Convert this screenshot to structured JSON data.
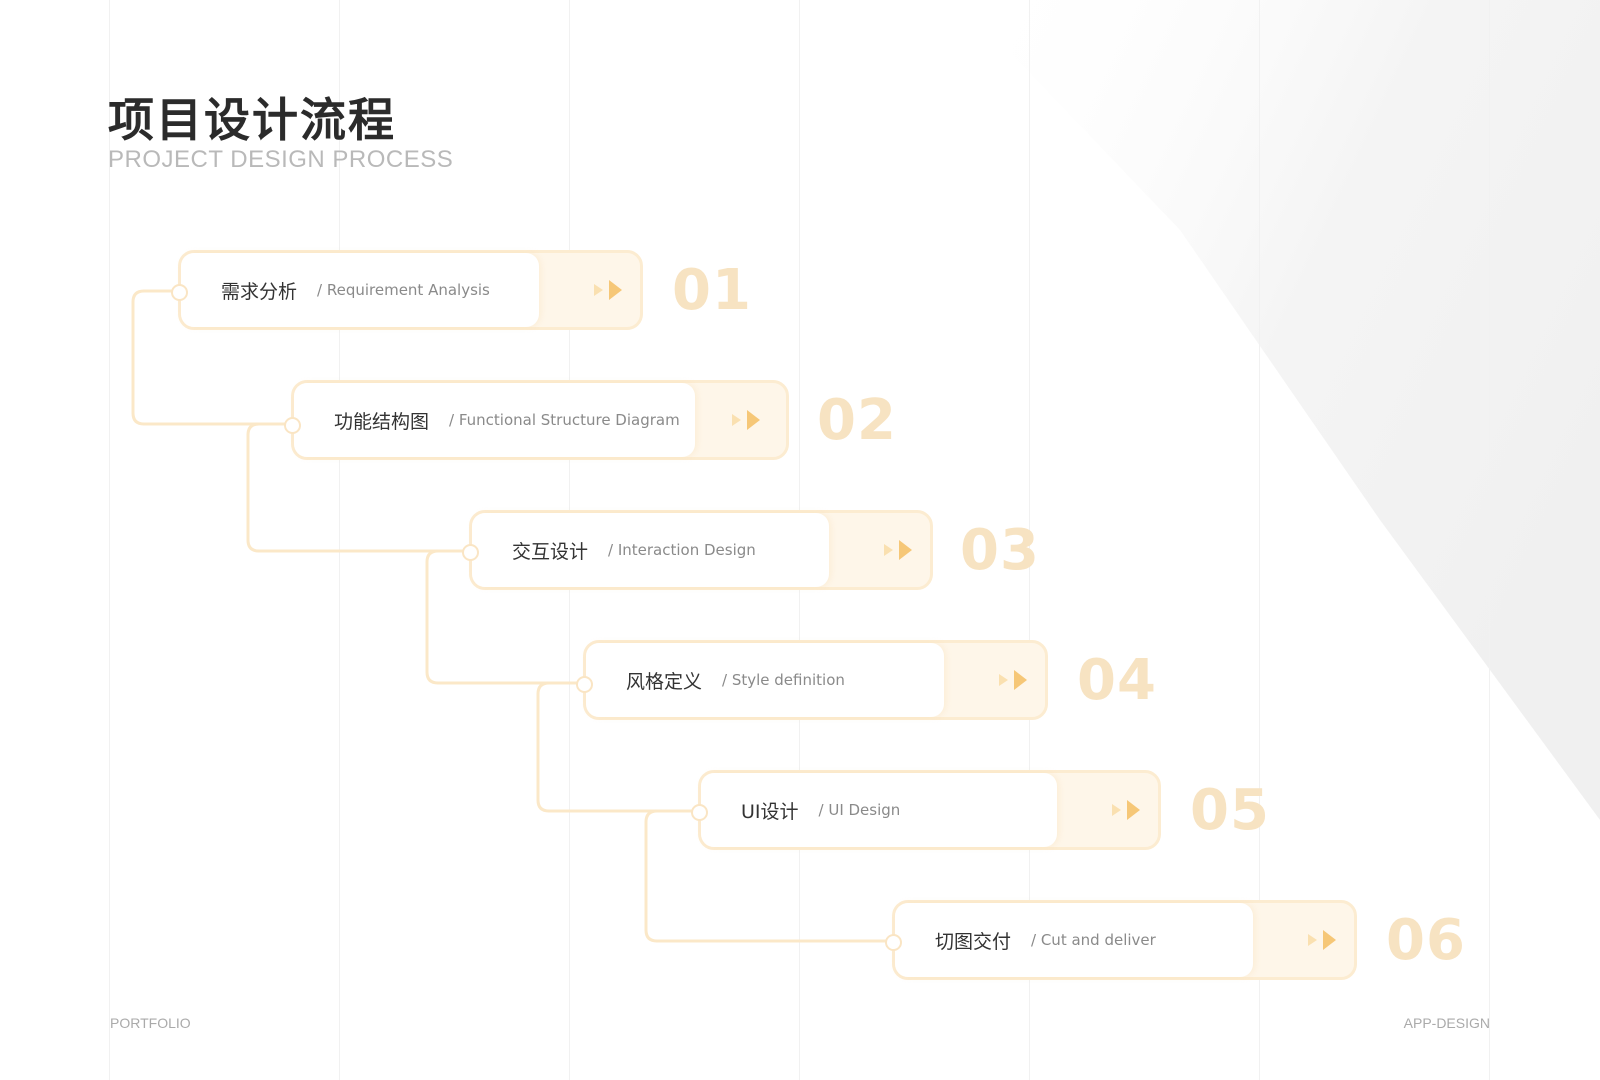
{
  "header": {
    "title_cn": "项目设计流程",
    "title_en": "PROJECT DESIGN PROCESS"
  },
  "steps": [
    {
      "cn": "需求分析",
      "en": "/ Requirement Analysis",
      "num": "01"
    },
    {
      "cn": "功能结构图",
      "en": "/ Functional Structure Diagram",
      "num": "02"
    },
    {
      "cn": "交互设计",
      "en": "/ Interaction Design",
      "num": "03"
    },
    {
      "cn": "风格定义",
      "en": "/ Style definition",
      "num": "04"
    },
    {
      "cn": "UI设计",
      "en": "/ UI Design",
      "num": "05"
    },
    {
      "cn": "切图交付",
      "en": "/ Cut and deliver",
      "num": "06"
    }
  ],
  "footer": {
    "left": "PORTFOLIO",
    "right": "APP-DESIGN"
  },
  "colors": {
    "accent": "#f6c777",
    "accent_light": "#fae0b0",
    "card_border": "#fcecd1",
    "card_tint": "#fef6e9",
    "number": "#f7e3c2",
    "title": "#2b2b2b"
  }
}
